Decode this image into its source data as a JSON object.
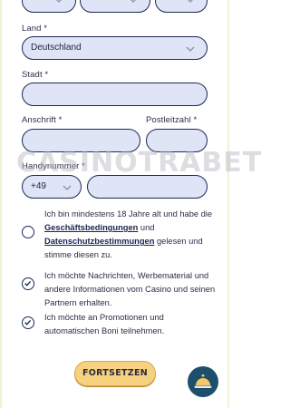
{
  "form": {
    "country_label": "Land *",
    "country_value": "Deutschland",
    "city_label": "Stadt *",
    "city_value": "",
    "address_label": "Anschrift *",
    "postcode_label": "Postleitzahl *",
    "phone_label": "Handynummer *",
    "phone_prefix": "+49"
  },
  "consents": {
    "terms_text_1": "Ich bin mindestens 18 Jahre alt und habe die ",
    "terms_link": "Geschäftsbedingungen",
    "terms_text_2": " und ",
    "privacy_link": "Datenschutzbestimmungen",
    "terms_text_3": " gelesen und stimme diesen zu.",
    "terms_checked": false,
    "news_text": "Ich möchte Nachrichten, Werbematerial und andere Informationen vom Casino und seinen Partnern erhalten.",
    "news_checked": true,
    "promo_text": "Ich möchte an Promotionen und automatischen Boni teilnehmen.",
    "promo_checked": true
  },
  "submit_label": "FORTSETZEN",
  "watermark": "CASINOTRABET",
  "colors": {
    "field_bg": "#dfe5f7",
    "field_border": "#1c2a55",
    "button_bg": "#f6d17f",
    "bell_bg": "#1d4e6b"
  }
}
